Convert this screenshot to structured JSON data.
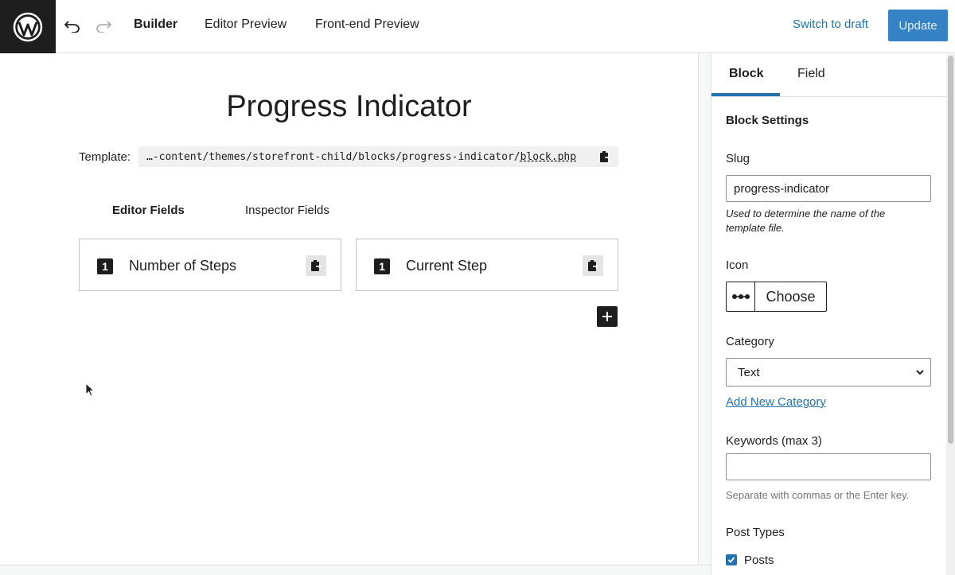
{
  "topbar": {
    "undo_icon": "undo-icon",
    "redo_icon": "redo-icon",
    "nav": [
      "Builder",
      "Editor Preview",
      "Front-end Preview"
    ],
    "switch_draft": "Switch to draft",
    "update": "Update"
  },
  "canvas": {
    "title": "Progress Indicator",
    "template_label": "Template:",
    "template_path_prefix": "…-content/themes/storefront-child/blocks/progress-indicator/",
    "template_file": "block.php",
    "tabs": [
      "Editor Fields",
      "Inspector Fields"
    ],
    "fields": [
      {
        "badge": "1",
        "name": "Number of Steps"
      },
      {
        "badge": "1",
        "name": "Current Step"
      }
    ]
  },
  "sidebar": {
    "tabs": [
      "Block",
      "Field"
    ],
    "heading": "Block Settings",
    "slug_label": "Slug",
    "slug_value": "progress-indicator",
    "slug_help": "Used to determine the name of the template file.",
    "icon_label": "Icon",
    "icon_choose": "Choose",
    "category_label": "Category",
    "category_value": "Text",
    "add_category": "Add New Category",
    "keywords_label": "Keywords (max 3)",
    "keywords_value": "",
    "keywords_help": "Separate with commas or the Enter key.",
    "post_types_label": "Post Types",
    "post_type_posts": "Posts"
  },
  "colors": {
    "accent": "#2271b1",
    "update_bg": "#3582c4",
    "dark": "#1e1e1e"
  }
}
